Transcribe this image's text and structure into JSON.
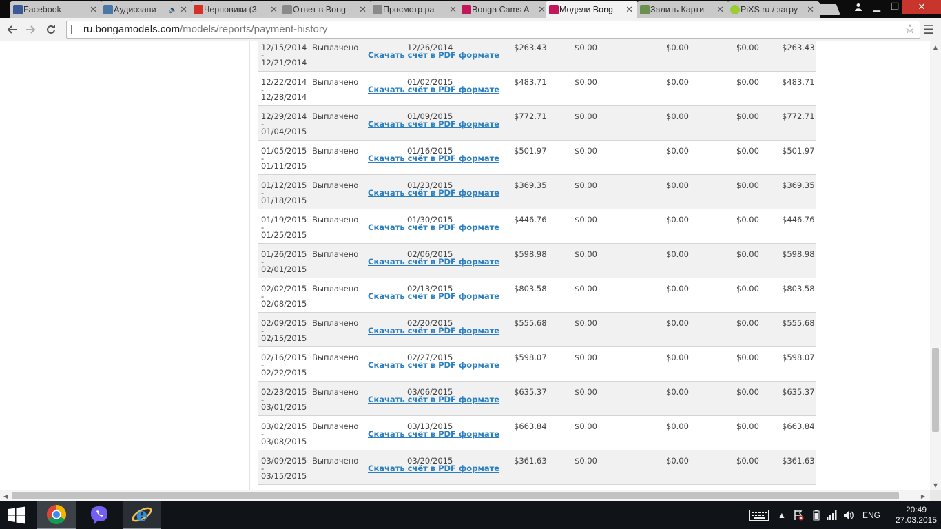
{
  "browser": {
    "tabs": [
      {
        "label": "Facebook",
        "favicon": "facebook-icon",
        "color": "#3b5998",
        "close": "✕",
        "active": false
      },
      {
        "label": "Аудиозапи",
        "favicon": "vk-icon",
        "color": "#4a76a8",
        "close": "✕",
        "active": false,
        "audio": true
      },
      {
        "label": "Черновики (3",
        "favicon": "gmail-icon",
        "color": "#d93025",
        "close": "✕",
        "active": false
      },
      {
        "label": "Ответ в Bong",
        "favicon": "forum-icon",
        "color": "#8a8a8a",
        "close": "✕",
        "active": false
      },
      {
        "label": "Просмотр ра",
        "favicon": "forum-icon",
        "color": "#8a8a8a",
        "close": "✕",
        "active": false
      },
      {
        "label": "Bonga Cams A",
        "favicon": "bonga-icon",
        "color": "#c2185b",
        "close": "✕",
        "active": false
      },
      {
        "label": "Модели Bong",
        "favicon": "bonga-icon",
        "color": "#c2185b",
        "close": "✕",
        "active": true
      },
      {
        "label": "Залить Карти",
        "favicon": "image-upload-icon",
        "color": "#6b8f4e",
        "close": "✕",
        "active": false
      },
      {
        "label": "PiXS.ru / загру",
        "favicon": "pixs-icon",
        "color": "#9acd32",
        "close": "✕",
        "active": false
      }
    ],
    "url_host": "ru.bongamodels.com",
    "url_path": "/models/reports/payment-history"
  },
  "payments": [
    {
      "period_start": "12/15/2014",
      "period_end": "12/21/2014",
      "status": "Выплачено",
      "pay_date": "12/26/2014",
      "link": "Скачать счёт в PDF формате",
      "amount": "$263.43",
      "col2": "$0.00",
      "col3": "$0.00",
      "col4": "$0.00",
      "total": "$263.43"
    },
    {
      "period_start": "12/22/2014",
      "period_end": "12/28/2014",
      "status": "Выплачено",
      "pay_date": "01/02/2015",
      "link": "Скачать счёт в PDF формате",
      "amount": "$483.71",
      "col2": "$0.00",
      "col3": "$0.00",
      "col4": "$0.00",
      "total": "$483.71"
    },
    {
      "period_start": "12/29/2014",
      "period_end": "01/04/2015",
      "status": "Выплачено",
      "pay_date": "01/09/2015",
      "link": "Скачать счёт в PDF формате",
      "amount": "$772.71",
      "col2": "$0.00",
      "col3": "$0.00",
      "col4": "$0.00",
      "total": "$772.71"
    },
    {
      "period_start": "01/05/2015",
      "period_end": "01/11/2015",
      "status": "Выплачено",
      "pay_date": "01/16/2015",
      "link": "Скачать счёт в PDF формате",
      "amount": "$501.97",
      "col2": "$0.00",
      "col3": "$0.00",
      "col4": "$0.00",
      "total": "$501.97"
    },
    {
      "period_start": "01/12/2015",
      "period_end": "01/18/2015",
      "status": "Выплачено",
      "pay_date": "01/23/2015",
      "link": "Скачать счёт в PDF формате",
      "amount": "$369.35",
      "col2": "$0.00",
      "col3": "$0.00",
      "col4": "$0.00",
      "total": "$369.35"
    },
    {
      "period_start": "01/19/2015",
      "period_end": "01/25/2015",
      "status": "Выплачено",
      "pay_date": "01/30/2015",
      "link": "Скачать счёт в PDF формате",
      "amount": "$446.76",
      "col2": "$0.00",
      "col3": "$0.00",
      "col4": "$0.00",
      "total": "$446.76"
    },
    {
      "period_start": "01/26/2015",
      "period_end": "02/01/2015",
      "status": "Выплачено",
      "pay_date": "02/06/2015",
      "link": "Скачать счёт в PDF формате",
      "amount": "$598.98",
      "col2": "$0.00",
      "col3": "$0.00",
      "col4": "$0.00",
      "total": "$598.98"
    },
    {
      "period_start": "02/02/2015",
      "period_end": "02/08/2015",
      "status": "Выплачено",
      "pay_date": "02/13/2015",
      "link": "Скачать счёт в PDF формате",
      "amount": "$803.58",
      "col2": "$0.00",
      "col3": "$0.00",
      "col4": "$0.00",
      "total": "$803.58"
    },
    {
      "period_start": "02/09/2015",
      "period_end": "02/15/2015",
      "status": "Выплачено",
      "pay_date": "02/20/2015",
      "link": "Скачать счёт в PDF формате",
      "amount": "$555.68",
      "col2": "$0.00",
      "col3": "$0.00",
      "col4": "$0.00",
      "total": "$555.68"
    },
    {
      "period_start": "02/16/2015",
      "period_end": "02/22/2015",
      "status": "Выплачено",
      "pay_date": "02/27/2015",
      "link": "Скачать счёт в PDF формате",
      "amount": "$598.07",
      "col2": "$0.00",
      "col3": "$0.00",
      "col4": "$0.00",
      "total": "$598.07"
    },
    {
      "period_start": "02/23/2015",
      "period_end": "03/01/2015",
      "status": "Выплачено",
      "pay_date": "03/06/2015",
      "link": "Скачать счёт в PDF формате",
      "amount": "$635.37",
      "col2": "$0.00",
      "col3": "$0.00",
      "col4": "$0.00",
      "total": "$635.37"
    },
    {
      "period_start": "03/02/2015",
      "period_end": "03/08/2015",
      "status": "Выплачено",
      "pay_date": "03/13/2015",
      "link": "Скачать счёт в PDF формате",
      "amount": "$663.84",
      "col2": "$0.00",
      "col3": "$0.00",
      "col4": "$0.00",
      "total": "$663.84"
    },
    {
      "period_start": "03/09/2015",
      "period_end": "03/15/2015",
      "status": "Выплачено",
      "pay_date": "03/20/2015",
      "link": "Скачать счёт в PDF формате",
      "amount": "$361.63",
      "col2": "$0.00",
      "col3": "$0.00",
      "col4": "$0.00",
      "total": "$361.63"
    }
  ],
  "taskbar": {
    "lang": "ENG",
    "time": "20:49",
    "date": "27.03.2015"
  }
}
